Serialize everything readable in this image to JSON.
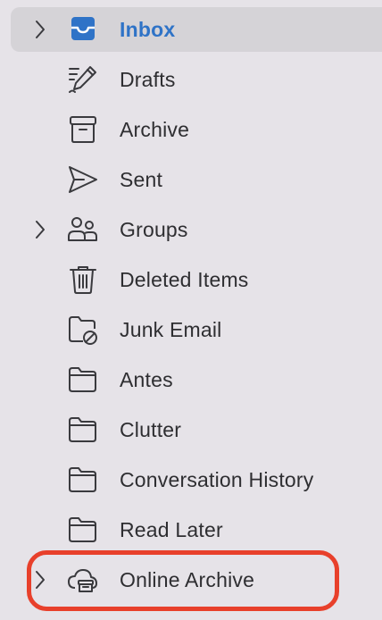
{
  "folders": [
    {
      "label": "Inbox",
      "icon": "inbox-icon",
      "expandable": true,
      "selected": true
    },
    {
      "label": "Drafts",
      "icon": "drafts-pencil-icon",
      "expandable": false,
      "selected": false
    },
    {
      "label": "Archive",
      "icon": "archive-box-icon",
      "expandable": false,
      "selected": false
    },
    {
      "label": "Sent",
      "icon": "paper-plane-icon",
      "expandable": false,
      "selected": false
    },
    {
      "label": "Groups",
      "icon": "people-icon",
      "expandable": true,
      "selected": false
    },
    {
      "label": "Deleted Items",
      "icon": "trash-icon",
      "expandable": false,
      "selected": false
    },
    {
      "label": "Junk Email",
      "icon": "junk-folder-icon",
      "expandable": false,
      "selected": false
    },
    {
      "label": "Antes",
      "icon": "folder-icon",
      "expandable": false,
      "selected": false
    },
    {
      "label": "Clutter",
      "icon": "folder-icon",
      "expandable": false,
      "selected": false
    },
    {
      "label": "Conversation History",
      "icon": "folder-icon",
      "expandable": false,
      "selected": false
    },
    {
      "label": "Read Later",
      "icon": "folder-icon",
      "expandable": false,
      "selected": false
    },
    {
      "label": "Online Archive",
      "icon": "cloud-archive-icon",
      "expandable": true,
      "selected": false
    }
  ],
  "colors": {
    "background": "#E6E3E8",
    "selected_row": "#D5D3D7",
    "accent": "#2F73C7",
    "icon_stroke": "#3A3A3E",
    "highlight_ring": "#E8402B"
  }
}
